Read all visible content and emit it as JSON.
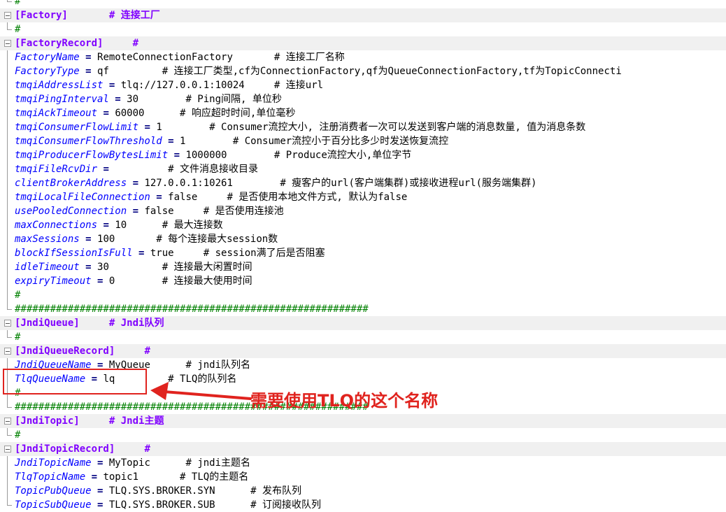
{
  "lines": [
    {
      "kind": "hash",
      "text": "#"
    },
    {
      "kind": "section",
      "section": "[Factory]",
      "pad": "       ",
      "comment": "# 连接工厂"
    },
    {
      "kind": "hash",
      "text": "#"
    },
    {
      "kind": "section",
      "section": "[FactoryRecord]",
      "pad": "     ",
      "comment": "#"
    },
    {
      "kind": "kv",
      "key": "FactoryName",
      "value": "RemoteConnectionFactory",
      "pad": "       ",
      "comment": "# 连接工厂名称"
    },
    {
      "kind": "kv",
      "key": "FactoryType",
      "value": "qf",
      "pad": "         ",
      "comment": "# 连接工厂类型,cf为ConnectionFactory,qf为QueueConnectionFactory,tf为TopicConnecti"
    },
    {
      "kind": "kv",
      "key": "tmqiAddressList",
      "value": "tlq://127.0.0.1:10024",
      "pad": "     ",
      "comment": "# 连接url"
    },
    {
      "kind": "kv",
      "key": "tmqiPingInterval",
      "value": "30",
      "pad": "        ",
      "comment": "# Ping间隔, 单位秒"
    },
    {
      "kind": "kv",
      "key": "tmqiAckTimeout",
      "value": "60000",
      "pad": "      ",
      "comment": "# 响应超时时间,单位毫秒"
    },
    {
      "kind": "kv",
      "key": "tmqiConsumerFlowLimit",
      "value": "1",
      "pad": "        ",
      "comment": "# Consumer流控大小, 注册消费者一次可以发送到客户端的消息数量, 值为消息条数"
    },
    {
      "kind": "kv",
      "key": "tmqiConsumerFlowThreshold",
      "value": "1",
      "pad": "        ",
      "comment": "# Consumer流控小于百分比多少时发送恢复流控"
    },
    {
      "kind": "kv",
      "key": "tmqiProducerFlowBytesLimit",
      "value": "1000000",
      "pad": "        ",
      "comment": "# Produce流控大小,单位字节"
    },
    {
      "kind": "kv",
      "key": "tmqiFileRcvDir",
      "value": "",
      "pad": "         ",
      "comment": "# 文件消息接收目录"
    },
    {
      "kind": "kv",
      "key": "clientBrokerAddress",
      "value": "127.0.0.1:10261",
      "pad": "        ",
      "comment": "# 瘦客户的url(客户端集群)或接收进程url(服务端集群)"
    },
    {
      "kind": "kv",
      "key": "tmqiLocalFileConnection",
      "value": "false",
      "pad": "     ",
      "comment": "# 是否使用本地文件方式, 默认为false"
    },
    {
      "kind": "kv",
      "key": "usePooledConnection",
      "value": "false",
      "pad": "     ",
      "comment": "# 是否使用连接池"
    },
    {
      "kind": "kv",
      "key": "maxConnections",
      "value": "10",
      "pad": "      ",
      "comment": "# 最大连接数"
    },
    {
      "kind": "kv",
      "key": "maxSessions",
      "value": "100",
      "pad": "       ",
      "comment": "# 每个连接最大session数"
    },
    {
      "kind": "kv",
      "key": "blockIfSessionIsFull",
      "value": "true",
      "pad": "     ",
      "comment": "# session满了后是否阻塞"
    },
    {
      "kind": "kv",
      "key": "idleTimeout",
      "value": "30",
      "pad": "         ",
      "comment": "# 连接最大闲置时间"
    },
    {
      "kind": "kv",
      "key": "expiryTimeout",
      "value": "0",
      "pad": "        ",
      "comment": "# 连接最大使用时间"
    },
    {
      "kind": "hash",
      "text": "#"
    },
    {
      "kind": "hash",
      "text": "############################################################"
    },
    {
      "kind": "section",
      "section": "[JndiQueue]",
      "pad": "     ",
      "comment": "# Jndi队列"
    },
    {
      "kind": "hash",
      "text": "#"
    },
    {
      "kind": "section",
      "section": "[JndiQueueRecord]",
      "pad": "     ",
      "comment": "#"
    },
    {
      "kind": "kv",
      "key": "JndiQueueName",
      "value": "MyQueue",
      "pad": "      ",
      "comment": "# jndi队列名"
    },
    {
      "kind": "kv",
      "key": "TlqQueueName",
      "value": "lq",
      "pad": "         ",
      "comment": "# TLQ的队列名"
    },
    {
      "kind": "hash",
      "text": "#"
    },
    {
      "kind": "hash",
      "text": "############################################################"
    },
    {
      "kind": "section",
      "section": "[JndiTopic]",
      "pad": "     ",
      "comment": "# Jndi主题"
    },
    {
      "kind": "hash",
      "text": "#"
    },
    {
      "kind": "section",
      "section": "[JndiTopicRecord]",
      "pad": "     ",
      "comment": "#"
    },
    {
      "kind": "kv",
      "key": "JndiTopicName",
      "value": "MyTopic",
      "pad": "      ",
      "comment": "# jndi主题名"
    },
    {
      "kind": "kv",
      "key": "TlqTopicName",
      "value": "topic1",
      "pad": "       ",
      "comment": "# TLQ的主题名"
    },
    {
      "kind": "kv",
      "key": "TopicPubQueue",
      "value": "TLQ.SYS.BROKER.SYN",
      "pad": "      ",
      "comment": "# 发布队列"
    },
    {
      "kind": "kv",
      "key": "TopicSubQueue",
      "value": "TLQ.SYS.BROKER.SUB",
      "pad": "      ",
      "comment": "# 订阅接收队列"
    }
  ],
  "annotation": {
    "callout_text": "需要使用TLQ的这个名称",
    "color": "#e0231e"
  },
  "colors": {
    "key": "#0000ff",
    "section": "#8000ff",
    "hash": "#008000",
    "section_bg": "#f0f0f0"
  }
}
